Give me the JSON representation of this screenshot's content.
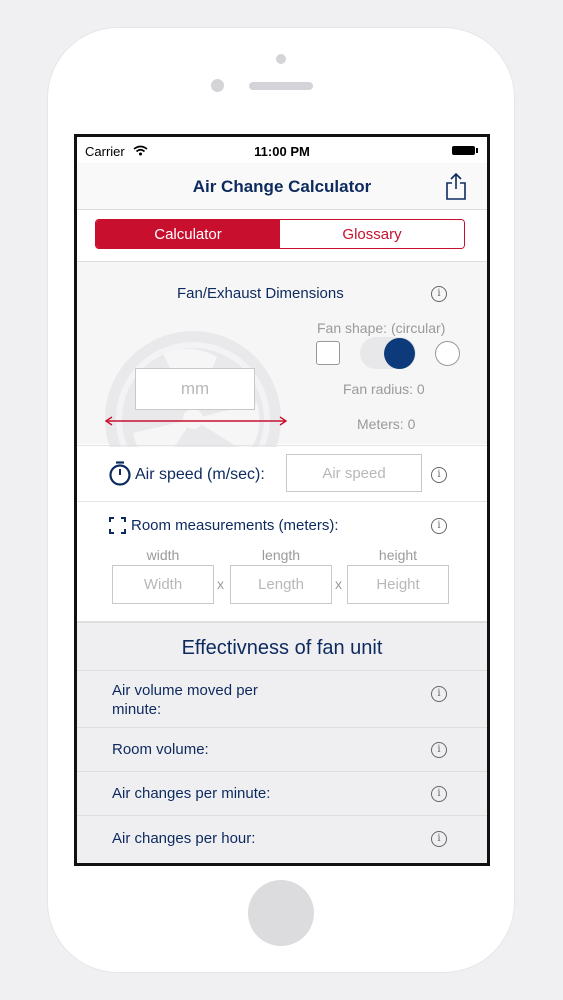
{
  "status": {
    "carrier": "Carrier",
    "time": "11:00 PM"
  },
  "nav": {
    "title": "Air Change Calculator",
    "share_icon": "share-icon"
  },
  "tabs": [
    {
      "label": "Calculator",
      "selected": true
    },
    {
      "label": "Glossary",
      "selected": false
    }
  ],
  "fan": {
    "heading": "Fan/Exhaust Dimensions",
    "shape_label": "Fan shape: (circular)",
    "diameter_placeholder": "mm",
    "radius_text": "Fan radius: 0",
    "meters_text": "Meters: 0"
  },
  "air_speed": {
    "label": "Air speed (m/sec):",
    "placeholder": "Air speed"
  },
  "room": {
    "label": "Room measurements (meters):",
    "width_caption": "width",
    "length_caption": "length",
    "height_caption": "height",
    "width_placeholder": "Width",
    "length_placeholder": "Length",
    "height_placeholder": "Height",
    "x1": "x",
    "x2": "x"
  },
  "effectiveness": {
    "title": "Effectivness of fan unit",
    "rows": [
      "Air volume moved per minute:",
      "Room volume:",
      "Air changes per minute:",
      "Air changes per hour:"
    ]
  },
  "colors": {
    "accent": "#c8102e",
    "navy": "#0d2a5e"
  }
}
